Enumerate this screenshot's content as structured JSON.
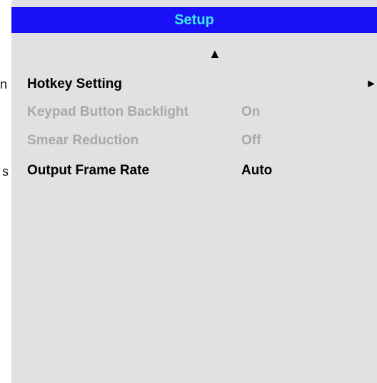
{
  "side_fragments": [
    "n",
    "s"
  ],
  "menu": {
    "title": "Setup",
    "scroll_up_glyph": "▲",
    "items": [
      {
        "label": "Hotkey Setting",
        "value": "",
        "submenu_glyph": "►",
        "enabled": true
      },
      {
        "label": "Keypad Button Backlight",
        "value": "On",
        "enabled": false
      },
      {
        "label": "Smear Reduction",
        "value": "Off",
        "enabled": false
      },
      {
        "label": "Output Frame Rate",
        "value": "Auto",
        "enabled": true
      }
    ]
  },
  "colors": {
    "title_bg": "#1a10f6",
    "title_text": "#3fe8f2",
    "panel_bg": "#e1e1e1",
    "enabled_text": "#000000",
    "disabled_text": "#a9a9a9"
  }
}
